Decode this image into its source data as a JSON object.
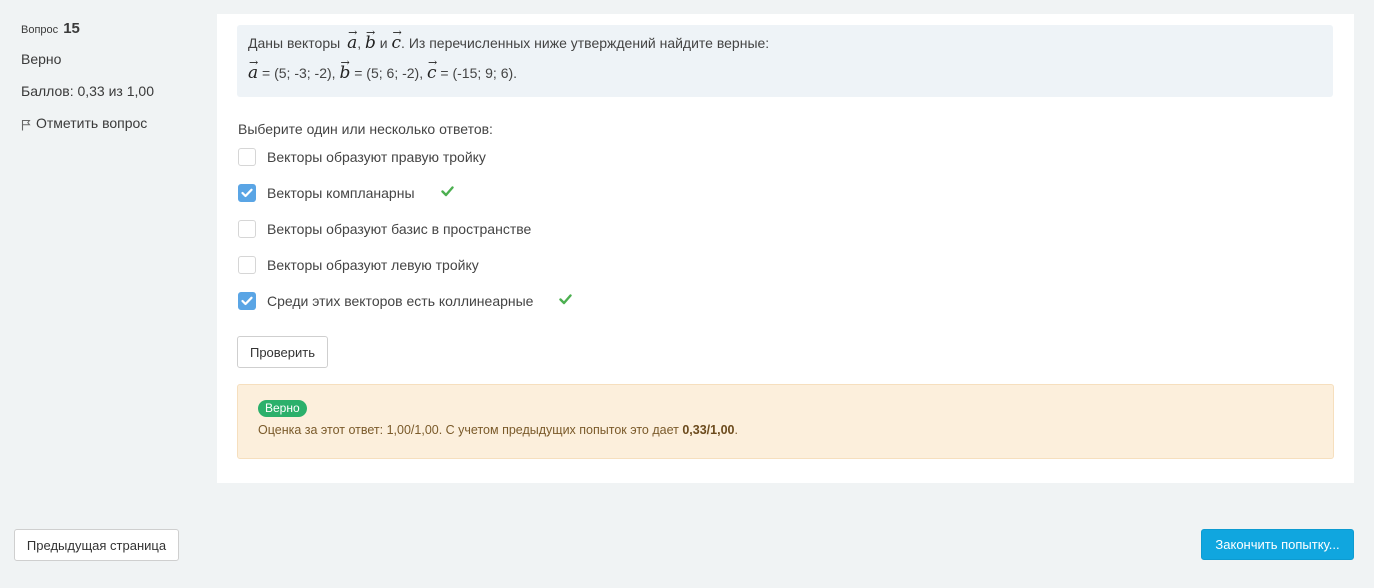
{
  "question_info": {
    "label": "Вопрос",
    "number": "15",
    "state": "Верно",
    "grade": "Баллов: 0,33 из 1,00",
    "flag_label": "Отметить вопрос"
  },
  "question": {
    "intro": "Даны векторы",
    "conjunction": "и",
    "statement": ". Из перечисленных ниже утверждений найдите верные:",
    "vector_arrow": "→",
    "vectors": [
      {
        "name": "a",
        "value": "= (5; -3; -2),"
      },
      {
        "name": "b",
        "value": "= (5; 6; -2),"
      },
      {
        "name": "c",
        "value": "= (-15; 9; 6)."
      }
    ]
  },
  "prompt": "Выберите один или несколько ответов:",
  "answers": [
    {
      "label": "Векторы образуют правую тройку",
      "checked": false,
      "correct": false
    },
    {
      "label": "Векторы компланарны",
      "checked": true,
      "correct": true
    },
    {
      "label": "Векторы образуют базис в пространстве",
      "checked": false,
      "correct": false
    },
    {
      "label": "Векторы образуют левую тройку",
      "checked": false,
      "correct": false
    },
    {
      "label": "Среди этих векторов есть коллинеарные",
      "checked": true,
      "correct": true
    }
  ],
  "check_button": "Проверить",
  "feedback": {
    "badge": "Верно",
    "text": "Оценка за этот ответ: 1,00/1,00. С учетом предыдущих попыток это дает",
    "total": "0,33/1,00",
    "suffix": "."
  },
  "nav": {
    "prev_label": "Предыдущая страница",
    "finish_label": "Закончить попытку..."
  },
  "colors": {
    "checkbox_checked": "#5aa5e5",
    "correct_check": "#4caf50",
    "badge_bg": "#2bb06b",
    "primary_button": "#10a6df",
    "feedback_bg": "#fcefdc"
  }
}
